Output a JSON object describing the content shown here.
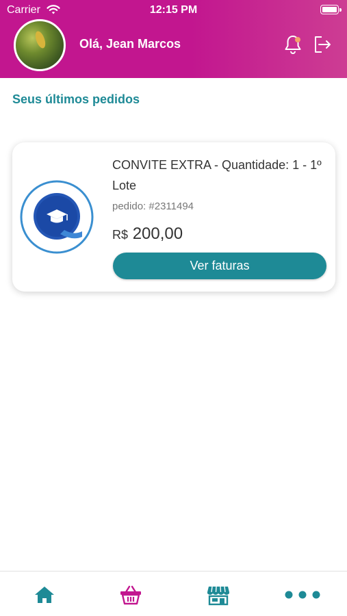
{
  "status_bar": {
    "carrier": "Carrier",
    "time": "12:15 PM"
  },
  "header": {
    "greeting": "Olá, Jean Marcos",
    "notification_icon": "bell-icon",
    "logout_icon": "logout-icon"
  },
  "section": {
    "title": "Seus últimos pedidos"
  },
  "orders": [
    {
      "product": "CONVITE EXTRA - Quantidade: 1 - 1º Lote",
      "order_number": "pedido: #2311494",
      "currency": "R$",
      "amount": "200,00",
      "action_label": "Ver faturas"
    }
  ],
  "tabbar": {
    "items": [
      {
        "icon": "home-icon",
        "color": "#1e8a96"
      },
      {
        "icon": "basket-icon",
        "color": "#c2168f"
      },
      {
        "icon": "store-icon",
        "color": "#1e8a96"
      },
      {
        "icon": "more-icon",
        "color": "#1e8a96"
      }
    ]
  },
  "colors": {
    "brand_pink": "#c2168f",
    "brand_teal": "#1e8a96"
  }
}
